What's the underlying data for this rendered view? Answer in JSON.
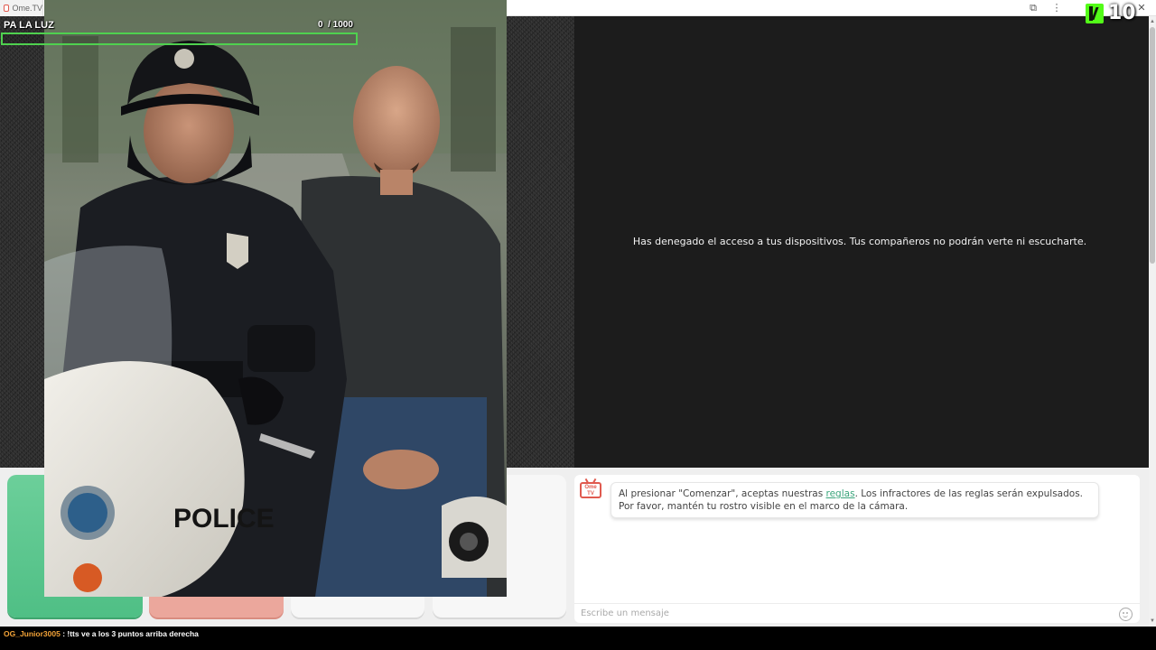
{
  "browser": {
    "tab_title": "Ome.TV",
    "extensions_icon": "puzzle-icon",
    "menu_icon": "kebab-menu-icon",
    "close_icon": "close-icon"
  },
  "overlay": {
    "goal_title": "PA LA LUZ",
    "goal_current": "0",
    "goal_sep": "/ 1000",
    "goal_progress": 0,
    "kick_count": "10",
    "goal_color": "#4fd14f",
    "kick_color": "#53fc18"
  },
  "video": {
    "denied_message": "Has denegado el acceso a tus dispositivos. Tus compañeros no podrán verte ni escucharte."
  },
  "chat": {
    "logo_text": "Ome TV",
    "rules_prefix": "Al presionar \"Comenzar\", aceptas nuestras ",
    "rules_link": "reglas",
    "rules_suffix": ". Los infractores de las reglas serán expulsados. Por favor, mantén tu rostro visible en el marco de la cámara.",
    "input_placeholder": "Escribe un mensaje",
    "emoji_icon": "smiley-icon"
  },
  "photo": {
    "badge_text": "POLICE"
  },
  "stream_chat": {
    "username": "OG_Junior3005",
    "message": " : !tts ve a los 3 puntos arriba derecha",
    "username_color": "#f3a338"
  },
  "colors": {
    "start_green": "#5cc78f",
    "stop_red": "#eba79c",
    "accent_link": "#3aa57b"
  }
}
